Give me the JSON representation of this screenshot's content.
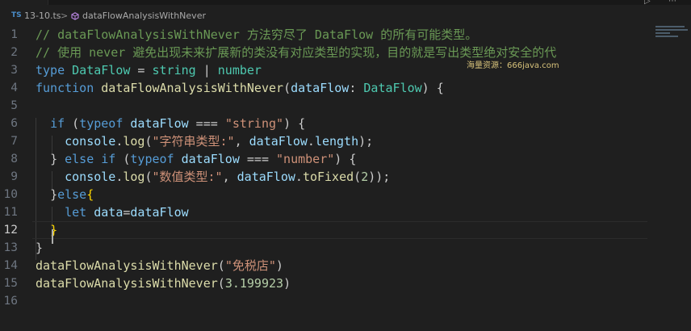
{
  "tab": {
    "fragment": "ts 10.ts"
  },
  "window_controls": {
    "run": "▷",
    "more": "⋯"
  },
  "breadcrumb": {
    "lang_badge": "TS",
    "file": "13-10.ts",
    "separator": ">",
    "symbol": "dataFlowAnalysisWithNever"
  },
  "watermark": "海量资源：666java.com",
  "colors": {
    "background": "#1f1f1f",
    "comment": "#6a9955",
    "keyword": "#569cd6",
    "type": "#4ec9b0",
    "function": "#dcdcaa",
    "variable": "#9cdcfe",
    "string": "#ce9178",
    "number": "#b5cea8"
  },
  "editor": {
    "current_line": 12,
    "lines": [
      {
        "n": "1",
        "t": {
          "c1": "// dataFlowAnalysisWithNever 方法穷尽了 DataFlow 的所有可能类型。"
        }
      },
      {
        "n": "2",
        "t": {
          "c1": "// 使用 never 避免出现未来扩展新的类没有对应类型的实现，目的就是写出类型绝对安全的代"
        }
      },
      {
        "n": "3",
        "t": {
          "k1": "type",
          "s1": " ",
          "t1": "DataFlow",
          "p1": " = ",
          "t2": "string",
          "p2": " | ",
          "t3": "number"
        }
      },
      {
        "n": "4",
        "t": {
          "k1": "function",
          "s1": " ",
          "f1": "dataFlowAnalysisWithNever",
          "p1": "(",
          "v1": "dataFlow",
          "p2": ": ",
          "t1": "DataFlow",
          "p3": ") {"
        }
      },
      {
        "n": "5",
        "t": {}
      },
      {
        "n": "6",
        "t": {
          "i1": "  ",
          "k1": "if",
          "p1": " (",
          "k2": "typeof",
          "s1": " ",
          "v1": "dataFlow",
          "p2": " === ",
          "st1": "\"string\"",
          "p3": ") {"
        }
      },
      {
        "n": "7",
        "t": {
          "i1": "    ",
          "v1": "console",
          "p1": ".",
          "f1": "log",
          "p2": "(",
          "st1": "\"字符串类型:\"",
          "p3": ", ",
          "v2": "dataFlow",
          "p4": ".",
          "v3": "length",
          "p5": ");"
        }
      },
      {
        "n": "8",
        "t": {
          "i1": "  ",
          "p1": "} ",
          "k1": "else",
          "s1": " ",
          "k2": "if",
          "p2": " (",
          "k3": "typeof",
          "s2": " ",
          "v1": "dataFlow",
          "p3": " === ",
          "st1": "\"number\"",
          "p4": ") {"
        }
      },
      {
        "n": "9",
        "t": {
          "i1": "    ",
          "v1": "console",
          "p1": ".",
          "f1": "log",
          "p2": "(",
          "st1": "\"数值类型:\"",
          "p3": ", ",
          "v2": "dataFlow",
          "p4": ".",
          "f2": "toFixed",
          "p5": "(",
          "n1": "2",
          "p6": "));"
        }
      },
      {
        "n": "10",
        "t": {
          "i1": "  ",
          "p1": "}",
          "k1": "else",
          "b1": "{"
        }
      },
      {
        "n": "11",
        "t": {
          "i1": "    ",
          "k1": "let",
          "s1": " ",
          "v1": "data",
          "p1": "=",
          "v2": "dataFlow"
        }
      },
      {
        "n": "12",
        "t": {
          "i1": "  ",
          "b1": "}"
        }
      },
      {
        "n": "13",
        "t": {
          "p1": "}"
        }
      },
      {
        "n": "14",
        "t": {
          "f1": "dataFlowAnalysisWithNever",
          "p1": "(",
          "st1": "\"免税店\"",
          "p2": ")"
        }
      },
      {
        "n": "15",
        "t": {
          "f1": "dataFlowAnalysisWithNever",
          "p1": "(",
          "n1": "3.199923",
          "p2": ")"
        }
      },
      {
        "n": "16",
        "t": {}
      }
    ]
  }
}
